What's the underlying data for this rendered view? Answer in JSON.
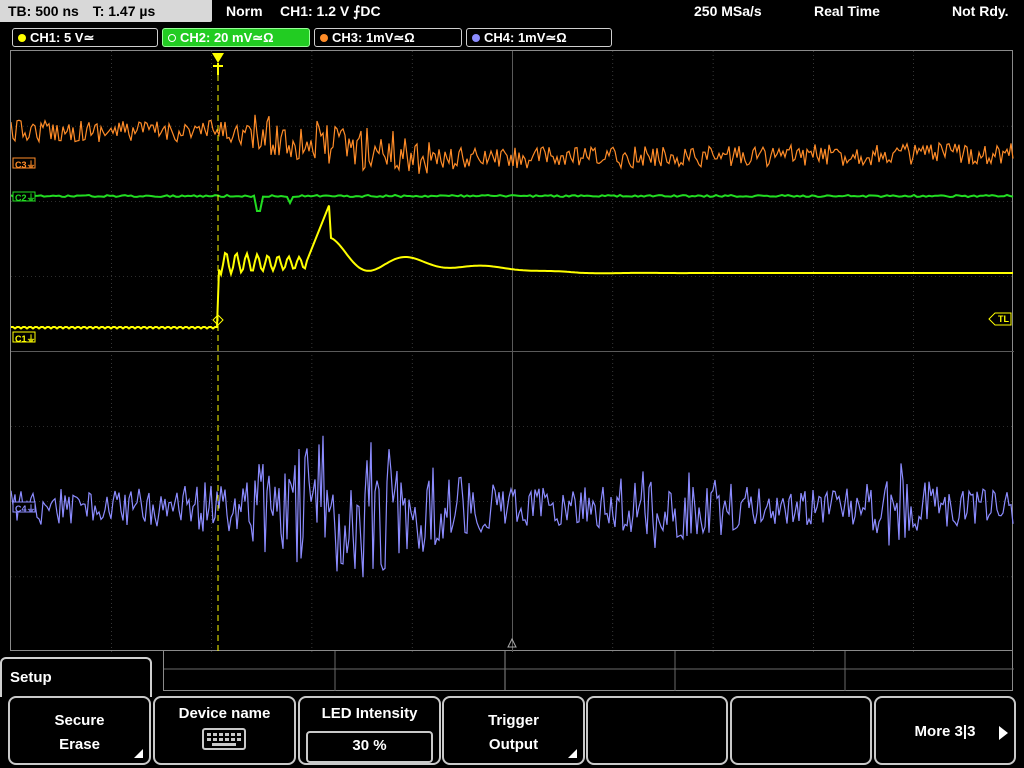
{
  "header": {
    "timebase": "TB: 500 ns",
    "trigger_time": "T: 1.47 µs",
    "mode": "Norm",
    "trigger_info": "CH1: 1.2 V ⨍DC",
    "sample_rate": "250 MSa/s",
    "acquisition": "Real Time",
    "state": "Not Rdy."
  },
  "channels": [
    {
      "label": "CH1: 5 V≃",
      "color": "#ffff00"
    },
    {
      "label": "CH2: 20 mV≃Ω",
      "color": "#22dd22"
    },
    {
      "label": "CH3: 1mV≃Ω",
      "color": "#ff8c28"
    },
    {
      "label": "CH4: 1mV≃Ω",
      "color": "#8c8cff"
    }
  ],
  "markers": {
    "c3": "C3⏚",
    "c2": "C2⏚",
    "c1": "C1⏚",
    "c4": "C4⏚",
    "tl": "TL",
    "trigger": "T"
  },
  "menu": {
    "title": "Setup",
    "softkeys": [
      {
        "line1": "Secure",
        "line2": "Erase"
      },
      {
        "line1": "Device name",
        "line2": ""
      },
      {
        "line1": "LED Intensity",
        "value": "30 %"
      },
      {
        "line1": "Trigger",
        "line2": "Output"
      },
      {
        "line1": "",
        "line2": ""
      },
      {
        "line1": "",
        "line2": ""
      },
      {
        "line1": "More 3|3",
        "line2": ""
      }
    ]
  },
  "colors": {
    "ch1": "#ffff00",
    "ch2": "#22dd22",
    "ch3": "#ff8c28",
    "ch4": "#8c8cff",
    "grid": "#5a5a5a",
    "active_tab": "#22cc22"
  }
}
